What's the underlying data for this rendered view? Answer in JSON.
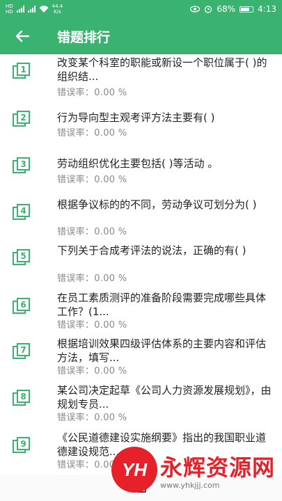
{
  "status_bar": {
    "hd1": "HD",
    "hd2": "HD",
    "net_speed": "44.4",
    "net_unit": "K/s",
    "battery": "68%",
    "time": "4:13"
  },
  "app_bar": {
    "title": "错题排行"
  },
  "colors": {
    "accent": "#3bb370",
    "icon": "#3bb370"
  },
  "questions": [
    {
      "num": "1",
      "text": "改变某个科室的职能或新设一个职位属于( )的组织结...",
      "rate_label": "错误率：",
      "rate": "0.00 %"
    },
    {
      "num": "2",
      "text": "行为导向型主观考评方法主要有(   )",
      "rate_label": "错误率：",
      "rate": "0.00 %"
    },
    {
      "num": "3",
      "text": "劳动组织优化主要包括(   )等活动 。",
      "rate_label": "错误率：",
      "rate": "0.00 %"
    },
    {
      "num": "4",
      "text": "根据争议标的的不同，劳动争议可划分为(   )",
      "rate_label": "错误率：",
      "rate": "0.00 %"
    },
    {
      "num": "5",
      "text": "下列关于合成考评法的说法，正确的有(   )",
      "rate_label": "错误率：",
      "rate": "0.00 %"
    },
    {
      "num": "6",
      "text": "在员工素质测评的准备阶段需要完成哪些具体工作？(1...",
      "rate_label": "错误率：",
      "rate": "0.00 %"
    },
    {
      "num": "7",
      "text": "根据培训效果四级评估体系的主要内容和评估方法，填写...",
      "rate_label": "错误率：",
      "rate": "0.00 %"
    },
    {
      "num": "8",
      "text": "某公司决定起草《公司人力资源发展规划》，由规划专员...",
      "rate_label": "错误率：",
      "rate": "0.00 %"
    },
    {
      "num": "9",
      "text": "《公民道德建设实施纲要》指出的我国职业道德建设规范...",
      "rate_label": "错误率：",
      "rate": "0.00 %"
    }
  ],
  "watermark": {
    "logo": "YH",
    "name": "永辉资源网",
    "url": "www.yhkjjj.com"
  }
}
